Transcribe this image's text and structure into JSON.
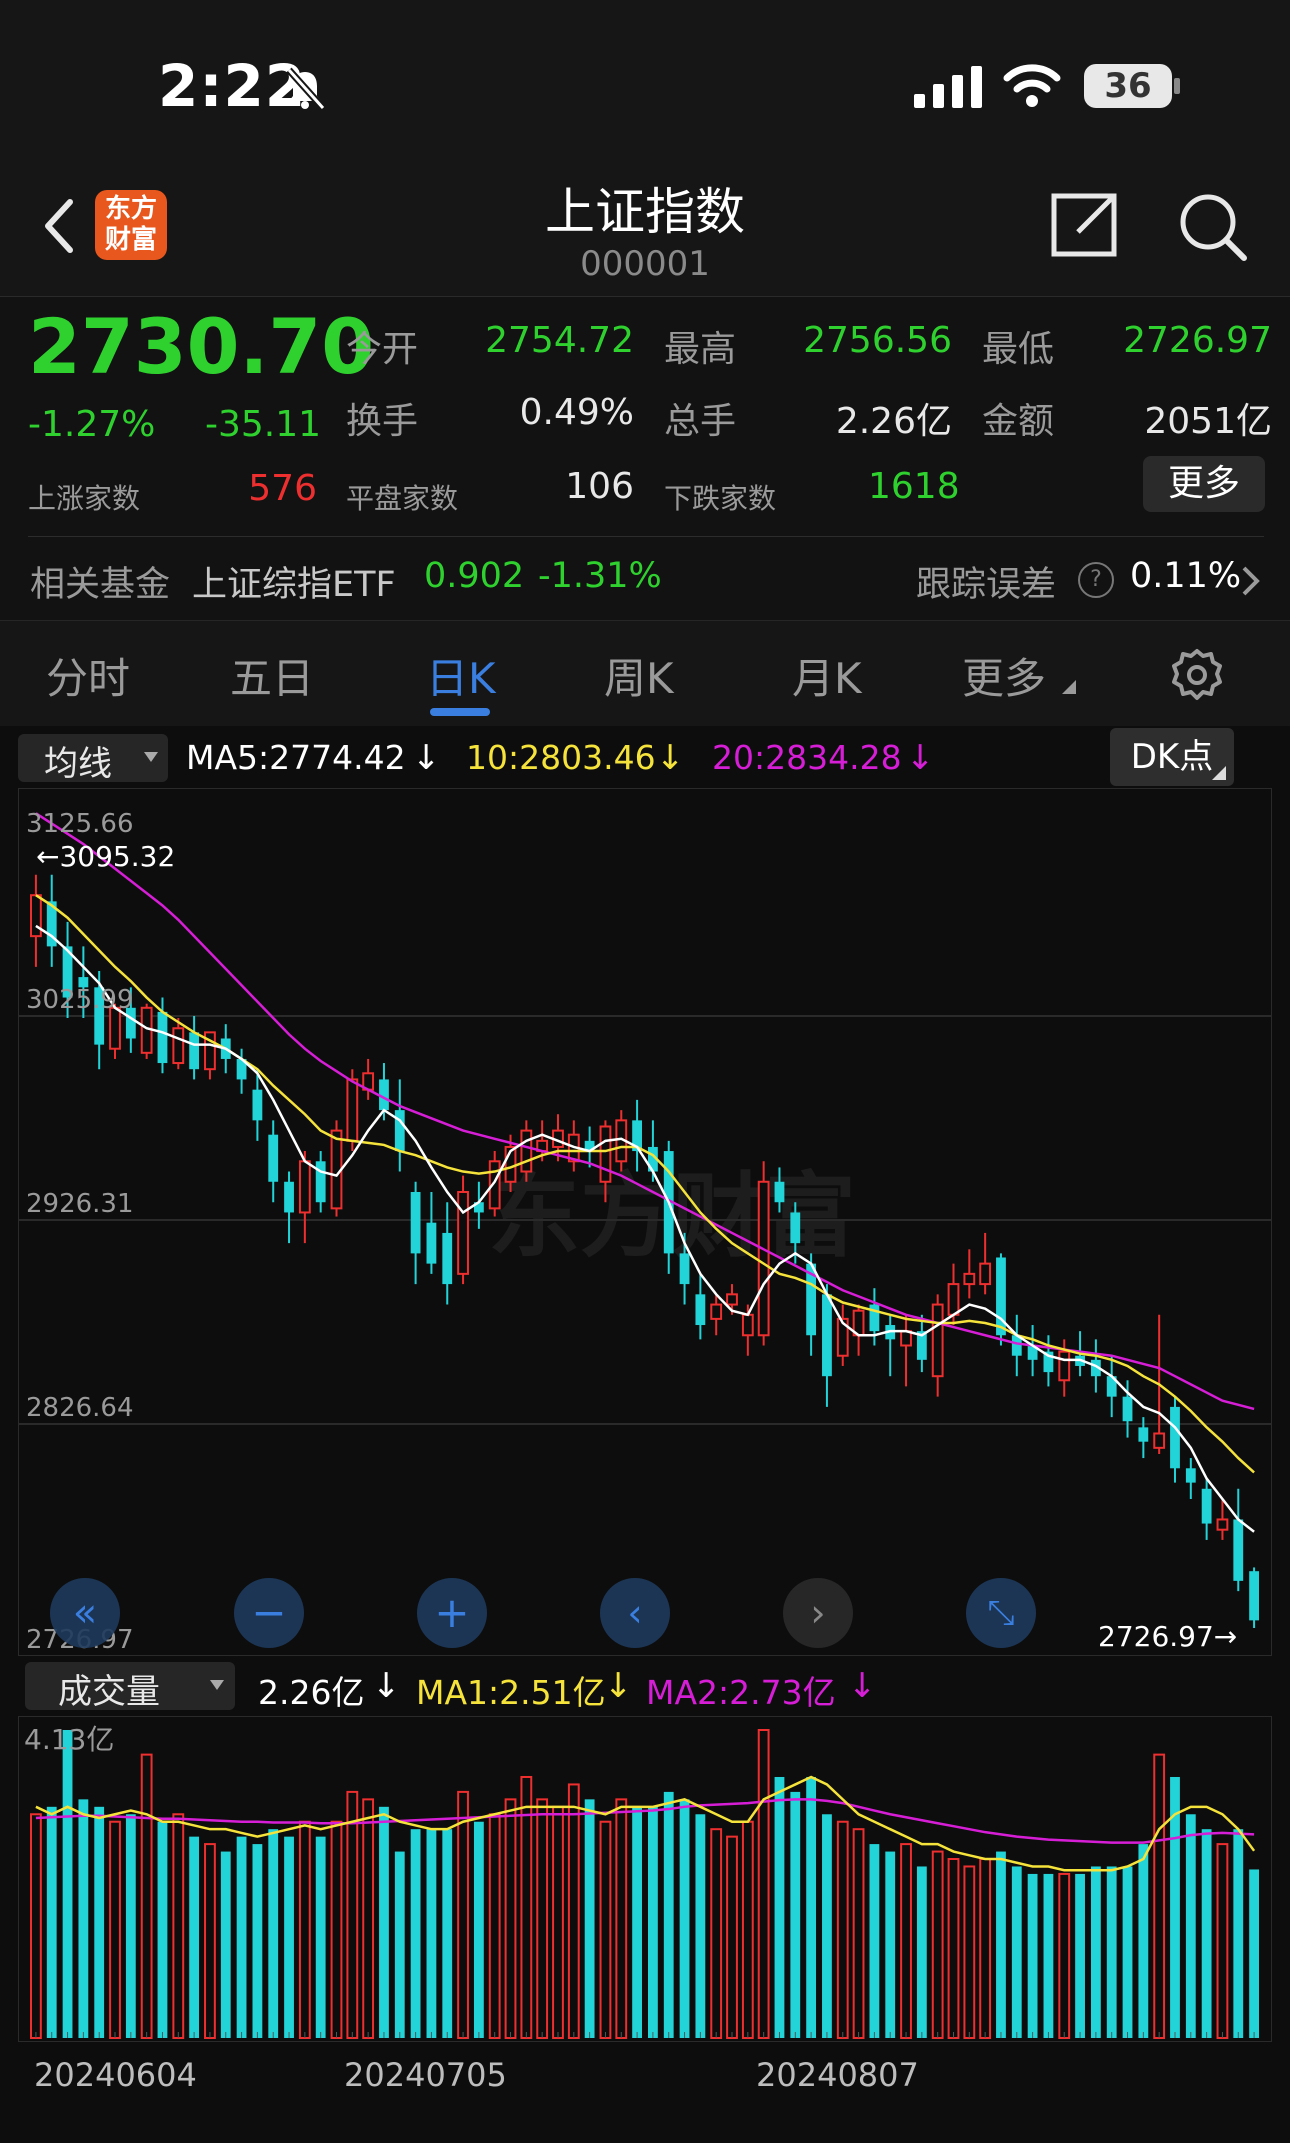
{
  "status_bar": {
    "time": "2:22",
    "battery": "36"
  },
  "header": {
    "title": "上证指数",
    "code": "000001",
    "logo_line1": "东方",
    "logo_line2": "财富"
  },
  "quote": {
    "price": "2730.70",
    "change_pct": "-1.27%",
    "change": "-35.11",
    "open_label": "今开",
    "open": "2754.72",
    "high_label": "最高",
    "high": "2756.56",
    "low_label": "最低",
    "low": "2726.97",
    "turnover_label": "换手",
    "turnover": "0.49%",
    "volume_label": "总手",
    "volume": "2.26亿",
    "amount_label": "金额",
    "amount": "2051亿",
    "up_label": "上涨家数",
    "up": "576",
    "flat_label": "平盘家数",
    "flat": "106",
    "down_label": "下跌家数",
    "down": "1618",
    "more_label": "更多"
  },
  "fund": {
    "label": "相关基金",
    "name": "上证综指ETF",
    "price": "0.902",
    "pct": "-1.31%",
    "track_label": "跟踪误差",
    "track_value": "0.11%"
  },
  "tabs": [
    {
      "label": "分时"
    },
    {
      "label": "五日"
    },
    {
      "label": "日K"
    },
    {
      "label": "周K"
    },
    {
      "label": "月K"
    },
    {
      "label": "更多"
    }
  ],
  "ma_bar": {
    "selector": "均线",
    "ma5": "MA5:2774.42",
    "ma10": "10:2803.46",
    "ma20": "20:2834.28",
    "dk": "DK点"
  },
  "vol_bar": {
    "selector": "成交量",
    "vol": "2.26亿",
    "ma1": "MA1:2.51亿",
    "ma2": "MA2:2.73亿"
  },
  "colors": {
    "up": "#ee2f2f",
    "down": "#22d4d8",
    "ma5": "#ffffff",
    "ma10": "#f5e33b",
    "ma20": "#d71ed7",
    "accent": "#3a7fe0"
  },
  "chart_data": {
    "type": "candlestick",
    "y_ticks": [
      "3125.66",
      "3025.99",
      "2926.31",
      "2826.64",
      "2726.97"
    ],
    "ylim": [
      2726.97,
      3125.66
    ],
    "high_marker": "3095.32",
    "low_marker": "2726.97",
    "x_labels": [
      "20240604",
      "20240705",
      "20240807"
    ],
    "vol_max_label": "4.13亿",
    "vol_max": 4.13,
    "candles": [
      {
        "o": 3065,
        "h": 3095,
        "c": 3085,
        "l": 3050,
        "v": 3.0
      },
      {
        "o": 3082,
        "h": 3095,
        "c": 3060,
        "l": 3050,
        "v": 3.1
      },
      {
        "o": 3060,
        "h": 3072,
        "c": 3035,
        "l": 3025,
        "v": 4.13
      },
      {
        "o": 3045,
        "h": 3060,
        "c": 3040,
        "l": 3025,
        "v": 3.2
      },
      {
        "o": 3040,
        "h": 3048,
        "c": 3012,
        "l": 3000,
        "v": 3.1
      },
      {
        "o": 3010,
        "h": 3032,
        "c": 3030,
        "l": 3005,
        "v": 2.9
      },
      {
        "o": 3030,
        "h": 3040,
        "c": 3015,
        "l": 3008,
        "v": 3.0
      },
      {
        "o": 3008,
        "h": 3032,
        "c": 3030,
        "l": 3005,
        "v": 3.8
      },
      {
        "o": 3028,
        "h": 3035,
        "c": 3003,
        "l": 2998,
        "v": 2.9
      },
      {
        "o": 3003,
        "h": 3025,
        "c": 3020,
        "l": 3000,
        "v": 3.0
      },
      {
        "o": 3018,
        "h": 3026,
        "c": 3000,
        "l": 2995,
        "v": 2.7
      },
      {
        "o": 3000,
        "h": 3012,
        "c": 3018,
        "l": 2995,
        "v": 2.6
      },
      {
        "o": 3015,
        "h": 3022,
        "c": 3005,
        "l": 2998,
        "v": 2.5
      },
      {
        "o": 3005,
        "h": 3010,
        "c": 2995,
        "l": 2988,
        "v": 2.7
      },
      {
        "o": 2990,
        "h": 3000,
        "c": 2975,
        "l": 2965,
        "v": 2.6
      },
      {
        "o": 2968,
        "h": 2975,
        "c": 2945,
        "l": 2935,
        "v": 2.8
      },
      {
        "o": 2945,
        "h": 2950,
        "c": 2930,
        "l": 2915,
        "v": 2.7
      },
      {
        "o": 2930,
        "h": 2960,
        "c": 2955,
        "l": 2915,
        "v": 2.9
      },
      {
        "o": 2955,
        "h": 2960,
        "c": 2935,
        "l": 2930,
        "v": 2.7
      },
      {
        "o": 2932,
        "h": 2975,
        "c": 2970,
        "l": 2928,
        "v": 2.9
      },
      {
        "o": 2965,
        "h": 3000,
        "c": 2995,
        "l": 2960,
        "v": 3.3
      },
      {
        "o": 2990,
        "h": 3005,
        "c": 2998,
        "l": 2985,
        "v": 3.2
      },
      {
        "o": 2995,
        "h": 3003,
        "c": 2980,
        "l": 2975,
        "v": 3.1
      },
      {
        "o": 2980,
        "h": 2995,
        "c": 2960,
        "l": 2950,
        "v": 2.5
      },
      {
        "o": 2940,
        "h": 2945,
        "c": 2910,
        "l": 2895,
        "v": 2.8
      },
      {
        "o": 2925,
        "h": 2940,
        "c": 2905,
        "l": 2900,
        "v": 2.8
      },
      {
        "o": 2920,
        "h": 2935,
        "c": 2895,
        "l": 2885,
        "v": 2.8
      },
      {
        "o": 2900,
        "h": 2948,
        "c": 2940,
        "l": 2895,
        "v": 3.3
      },
      {
        "o": 2935,
        "h": 2945,
        "c": 2930,
        "l": 2922,
        "v": 2.9
      },
      {
        "o": 2932,
        "h": 2960,
        "c": 2955,
        "l": 2928,
        "v": 3.0
      },
      {
        "o": 2945,
        "h": 2968,
        "c": 2962,
        "l": 2940,
        "v": 3.2
      },
      {
        "o": 2950,
        "h": 2975,
        "c": 2970,
        "l": 2945,
        "v": 3.5
      },
      {
        "o": 2960,
        "h": 2975,
        "c": 2965,
        "l": 2955,
        "v": 3.2
      },
      {
        "o": 2962,
        "h": 2978,
        "c": 2970,
        "l": 2955,
        "v": 3.1
      },
      {
        "o": 2955,
        "h": 2975,
        "c": 2968,
        "l": 2950,
        "v": 3.4
      },
      {
        "o": 2965,
        "h": 2972,
        "c": 2960,
        "l": 2952,
        "v": 3.2
      },
      {
        "o": 2945,
        "h": 2975,
        "c": 2972,
        "l": 2935,
        "v": 2.9
      },
      {
        "o": 2955,
        "h": 2980,
        "c": 2975,
        "l": 2950,
        "v": 3.2
      },
      {
        "o": 2975,
        "h": 2985,
        "c": 2960,
        "l": 2950,
        "v": 3.1
      },
      {
        "o": 2962,
        "h": 2975,
        "c": 2950,
        "l": 2945,
        "v": 3.1
      },
      {
        "o": 2960,
        "h": 2965,
        "c": 2910,
        "l": 2900,
        "v": 3.3
      },
      {
        "o": 2910,
        "h": 2920,
        "c": 2895,
        "l": 2885,
        "v": 3.2
      },
      {
        "o": 2890,
        "h": 2900,
        "c": 2875,
        "l": 2868,
        "v": 3.0
      },
      {
        "o": 2878,
        "h": 2890,
        "c": 2885,
        "l": 2870,
        "v": 2.8
      },
      {
        "o": 2885,
        "h": 2895,
        "c": 2890,
        "l": 2880,
        "v": 2.7
      },
      {
        "o": 2870,
        "h": 2885,
        "c": 2880,
        "l": 2860,
        "v": 2.9
      },
      {
        "o": 2870,
        "h": 2955,
        "c": 2945,
        "l": 2865,
        "v": 4.13
      },
      {
        "o": 2945,
        "h": 2952,
        "c": 2935,
        "l": 2930,
        "v": 3.5
      },
      {
        "o": 2930,
        "h": 2935,
        "c": 2915,
        "l": 2905,
        "v": 3.3
      },
      {
        "o": 2905,
        "h": 2910,
        "c": 2870,
        "l": 2860,
        "v": 3.5
      },
      {
        "o": 2890,
        "h": 2895,
        "c": 2850,
        "l": 2835,
        "v": 3.0
      },
      {
        "o": 2860,
        "h": 2885,
        "c": 2878,
        "l": 2855,
        "v": 2.9
      },
      {
        "o": 2870,
        "h": 2885,
        "c": 2882,
        "l": 2860,
        "v": 2.8
      },
      {
        "o": 2885,
        "h": 2893,
        "c": 2872,
        "l": 2865,
        "v": 2.6
      },
      {
        "o": 2875,
        "h": 2880,
        "c": 2868,
        "l": 2850,
        "v": 2.5
      },
      {
        "o": 2865,
        "h": 2880,
        "c": 2872,
        "l": 2845,
        "v": 2.6
      },
      {
        "o": 2872,
        "h": 2880,
        "c": 2858,
        "l": 2852,
        "v": 2.3
      },
      {
        "o": 2850,
        "h": 2890,
        "c": 2885,
        "l": 2840,
        "v": 2.5
      },
      {
        "o": 2880,
        "h": 2905,
        "c": 2895,
        "l": 2875,
        "v": 2.4
      },
      {
        "o": 2895,
        "h": 2912,
        "c": 2900,
        "l": 2888,
        "v": 2.3
      },
      {
        "o": 2895,
        "h": 2920,
        "c": 2905,
        "l": 2890,
        "v": 2.4
      },
      {
        "o": 2908,
        "h": 2910,
        "c": 2870,
        "l": 2865,
        "v": 2.5
      },
      {
        "o": 2870,
        "h": 2880,
        "c": 2860,
        "l": 2850,
        "v": 2.3
      },
      {
        "o": 2865,
        "h": 2875,
        "c": 2858,
        "l": 2850,
        "v": 2.2
      },
      {
        "o": 2862,
        "h": 2870,
        "c": 2852,
        "l": 2845,
        "v": 2.2
      },
      {
        "o": 2848,
        "h": 2868,
        "c": 2862,
        "l": 2840,
        "v": 2.2
      },
      {
        "o": 2860,
        "h": 2872,
        "c": 2855,
        "l": 2850,
        "v": 2.2
      },
      {
        "o": 2858,
        "h": 2868,
        "c": 2850,
        "l": 2842,
        "v": 2.3
      },
      {
        "o": 2850,
        "h": 2860,
        "c": 2840,
        "l": 2830,
        "v": 2.3
      },
      {
        "o": 2840,
        "h": 2848,
        "c": 2828,
        "l": 2820,
        "v": 2.3
      },
      {
        "o": 2825,
        "h": 2830,
        "c": 2818,
        "l": 2810,
        "v": 2.6
      },
      {
        "o": 2815,
        "h": 2880,
        "c": 2822,
        "l": 2812,
        "v": 3.8
      },
      {
        "o": 2835,
        "h": 2840,
        "c": 2805,
        "l": 2798,
        "v": 3.5
      },
      {
        "o": 2805,
        "h": 2810,
        "c": 2798,
        "l": 2790,
        "v": 3.0
      },
      {
        "o": 2795,
        "h": 2800,
        "c": 2778,
        "l": 2770,
        "v": 2.8
      },
      {
        "o": 2775,
        "h": 2790,
        "c": 2780,
        "l": 2770,
        "v": 2.6
      },
      {
        "o": 2780,
        "h": 2795,
        "c": 2750,
        "l": 2745,
        "v": 2.8
      },
      {
        "o": 2754.72,
        "h": 2756.56,
        "c": 2730.7,
        "l": 2726.97,
        "v": 2.26
      }
    ],
    "ma5": [
      3070,
      3065,
      3058,
      3050,
      3042,
      3030,
      3025,
      3020,
      3018,
      3015,
      3012,
      3012,
      3010,
      3005,
      2998,
      2985,
      2970,
      2955,
      2950,
      2948,
      2958,
      2970,
      2980,
      2975,
      2965,
      2952,
      2940,
      2930,
      2935,
      2945,
      2960,
      2965,
      2968,
      2965,
      2962,
      2960,
      2965,
      2966,
      2962,
      2950,
      2935,
      2915,
      2900,
      2890,
      2882,
      2880,
      2895,
      2905,
      2910,
      2905,
      2890,
      2876,
      2870,
      2870,
      2872,
      2872,
      2870,
      2875,
      2880,
      2885,
      2883,
      2878,
      2870,
      2865,
      2860,
      2858,
      2858,
      2855,
      2850,
      2842,
      2835,
      2832,
      2825,
      2815,
      2800,
      2790,
      2780,
      2774
    ],
    "ma10": [
      3085,
      3080,
      3074,
      3066,
      3058,
      3050,
      3043,
      3035,
      3028,
      3023,
      3018,
      3014,
      3010,
      3005,
      3000,
      2992,
      2985,
      2978,
      2970,
      2966,
      2965,
      2964,
      2963,
      2960,
      2958,
      2955,
      2952,
      2950,
      2949,
      2950,
      2952,
      2955,
      2958,
      2960,
      2960,
      2960,
      2960,
      2962,
      2962,
      2958,
      2950,
      2940,
      2930,
      2922,
      2915,
      2910,
      2905,
      2900,
      2898,
      2895,
      2890,
      2886,
      2884,
      2882,
      2880,
      2878,
      2877,
      2876,
      2876,
      2877,
      2876,
      2874,
      2870,
      2868,
      2865,
      2863,
      2861,
      2860,
      2858,
      2855,
      2850,
      2846,
      2840,
      2833,
      2825,
      2818,
      2810,
      2803
    ],
    "ma20": [
      3125,
      3120,
      3115,
      3110,
      3104,
      3098,
      3092,
      3086,
      3080,
      3073,
      3065,
      3057,
      3049,
      3041,
      3033,
      3025,
      3017,
      3010,
      3004,
      2999,
      2994,
      2990,
      2986,
      2982,
      2979,
      2976,
      2973,
      2970,
      2968,
      2966,
      2964,
      2962,
      2960,
      2958,
      2956,
      2954,
      2951,
      2948,
      2944,
      2940,
      2936,
      2932,
      2928,
      2924,
      2920,
      2916,
      2912,
      2908,
      2904,
      2900,
      2896,
      2892,
      2889,
      2886,
      2883,
      2880,
      2878,
      2876,
      2874,
      2872,
      2870,
      2868,
      2866,
      2865,
      2864,
      2863,
      2862,
      2861,
      2860,
      2858,
      2856,
      2854,
      2850,
      2846,
      2842,
      2838,
      2836,
      2834
    ],
    "vma1": [
      3.1,
      3.0,
      3.1,
      3.0,
      2.95,
      3.0,
      3.05,
      3.0,
      2.9,
      2.9,
      2.85,
      2.8,
      2.8,
      2.75,
      2.7,
      2.75,
      2.8,
      2.85,
      2.8,
      2.85,
      2.9,
      2.95,
      3.0,
      2.9,
      2.85,
      2.8,
      2.8,
      2.9,
      2.95,
      3.0,
      3.05,
      3.1,
      3.1,
      3.1,
      3.1,
      3.05,
      3.0,
      3.1,
      3.1,
      3.1,
      3.15,
      3.2,
      3.1,
      3.0,
      2.9,
      2.9,
      3.2,
      3.3,
      3.4,
      3.5,
      3.4,
      3.2,
      3.0,
      2.9,
      2.8,
      2.7,
      2.6,
      2.6,
      2.5,
      2.45,
      2.4,
      2.4,
      2.35,
      2.3,
      2.3,
      2.25,
      2.25,
      2.25,
      2.25,
      2.3,
      2.4,
      2.8,
      3.0,
      3.1,
      3.1,
      3.0,
      2.8,
      2.51
    ],
    "vma2": [
      2.95,
      2.96,
      2.97,
      2.98,
      2.98,
      2.97,
      2.96,
      2.95,
      2.94,
      2.94,
      2.93,
      2.92,
      2.91,
      2.9,
      2.9,
      2.89,
      2.89,
      2.89,
      2.88,
      2.88,
      2.88,
      2.89,
      2.9,
      2.91,
      2.92,
      2.93,
      2.94,
      2.95,
      2.96,
      2.97,
      2.98,
      2.99,
      3.0,
      3.0,
      3.0,
      3.01,
      3.02,
      3.03,
      3.04,
      3.05,
      3.07,
      3.1,
      3.12,
      3.13,
      3.14,
      3.15,
      3.17,
      3.19,
      3.2,
      3.2,
      3.18,
      3.15,
      3.1,
      3.05,
      3.0,
      2.96,
      2.92,
      2.88,
      2.84,
      2.8,
      2.76,
      2.73,
      2.7,
      2.68,
      2.66,
      2.65,
      2.64,
      2.63,
      2.62,
      2.62,
      2.62,
      2.65,
      2.68,
      2.72,
      2.74,
      2.75,
      2.74,
      2.73
    ]
  }
}
